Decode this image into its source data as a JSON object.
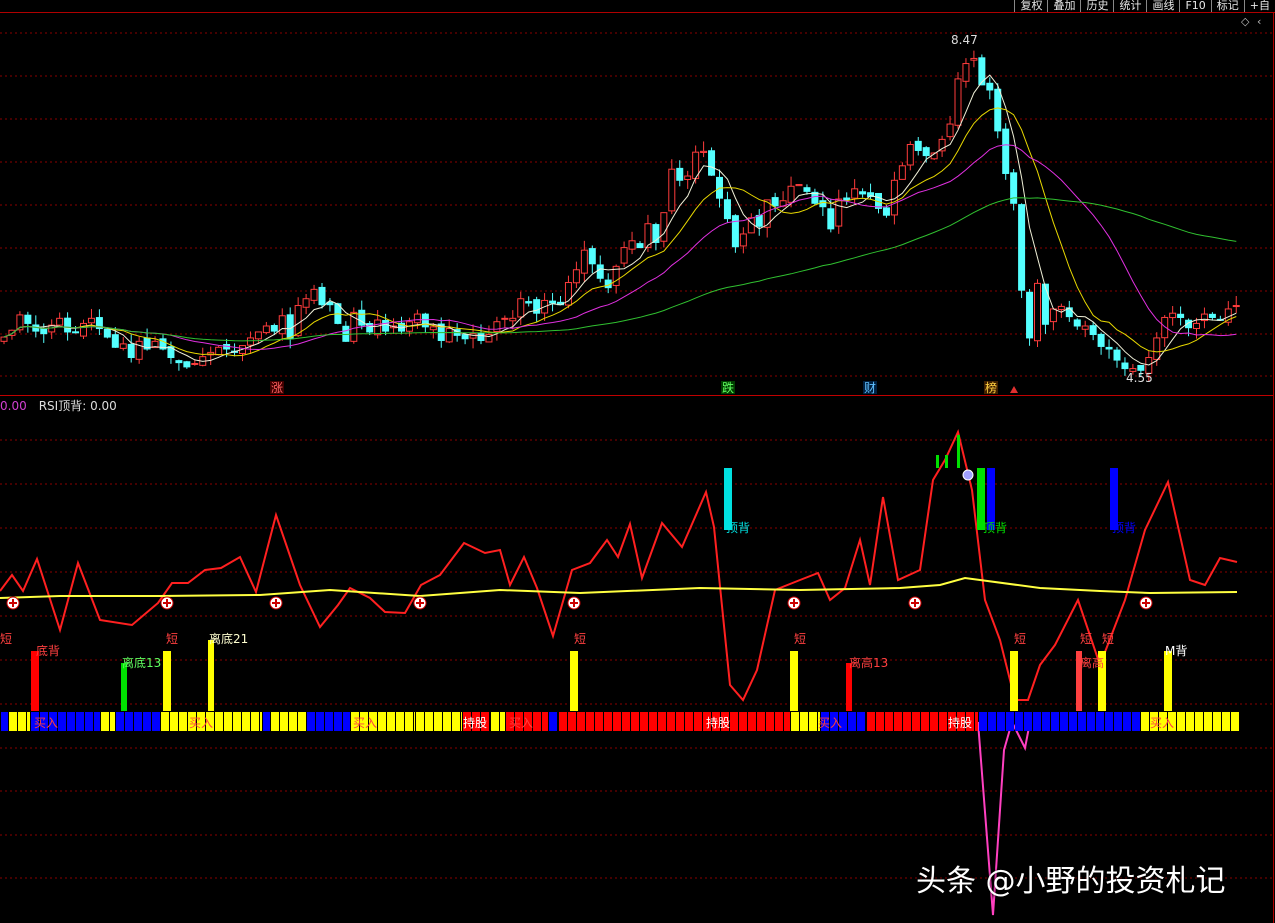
{
  "toolbar": {
    "items": [
      "复权",
      "叠加",
      "历史",
      "统计",
      "画线",
      "F10",
      "标记",
      "+自"
    ]
  },
  "indicator_header": {
    "value_a": "0.00",
    "label": "RSI顶背: 0.00"
  },
  "watermark": "头条 @小野的投资札记",
  "colors": {
    "background": "#000000",
    "grid": "#8a0000",
    "up_candle": "#ff3c3c",
    "down_candle": "#54ffff",
    "ma_white": "#f0f0d8",
    "ma_yellow": "#e8d800",
    "ma_magenta": "#e030e0",
    "ma_green": "#30c030",
    "rsi_line": "#ff2020",
    "rsi_avg": "#ffff40",
    "state_red": "#ff0000",
    "state_blue": "#0000ff",
    "state_yellow": "#ffff00"
  },
  "chart_data": [
    {
      "type": "candlestick",
      "price_annotations": {
        "high": "8.47",
        "low": "4.55"
      },
      "event_markers": [
        "涨",
        "跌",
        "财",
        "榜"
      ],
      "closes": [
        4.96,
        5.04,
        5.22,
        5.12,
        5.03,
        5.0,
        5.1,
        5.18,
        5.02,
        5.01,
        5.12,
        5.18,
        5.06,
        4.96,
        4.84,
        4.88,
        4.72,
        4.91,
        4.82,
        4.91,
        4.82,
        4.72,
        4.66,
        4.61,
        4.65,
        4.73,
        4.78,
        4.84,
        4.82,
        4.78,
        4.86,
        4.95,
        5.02,
        5.09,
        5.03,
        5.21,
        4.94,
        5.33,
        5.41,
        5.52,
        5.34,
        5.34,
        5.12,
        4.91,
        5.25,
        5.1,
        5.02,
        5.16,
        5.03,
        5.09,
        5.03,
        5.14,
        5.23,
        5.08,
        5.08,
        4.92,
        5.06,
        4.98,
        4.94,
        5.0,
        4.92,
        4.99,
        5.14,
        5.18,
        5.18,
        5.41,
        5.36,
        5.24,
        5.39,
        5.36,
        5.34,
        5.6,
        5.75,
        5.98,
        5.82,
        5.65,
        5.54,
        5.79,
        6.01,
        6.09,
        6.01,
        6.29,
        6.07,
        6.42,
        6.93,
        6.8,
        6.85,
        7.13,
        7.14,
        6.86,
        6.59,
        6.35,
        6.02,
        6.17,
        6.36,
        6.26,
        6.57,
        6.5,
        6.56,
        6.73,
        6.75,
        6.67,
        6.53,
        6.49,
        6.23,
        6.58,
        6.57,
        6.7,
        6.64,
        6.61,
        6.47,
        6.39,
        6.8,
        6.97,
        7.22,
        7.15,
        7.09,
        7.12,
        7.28,
        7.46,
        7.99,
        8.17,
        8.23,
        7.92,
        7.86,
        7.38,
        6.88,
        6.53,
        5.51,
        4.95,
        5.59,
        5.11,
        5.29,
        5.32,
        5.2,
        5.09,
        5.09,
        4.99,
        4.85,
        4.82,
        4.69,
        4.59,
        4.59,
        4.57,
        4.72,
        4.95,
        5.19,
        5.24,
        5.19,
        5.07,
        5.12,
        5.23,
        5.19,
        5.16,
        5.29,
        5.33
      ],
      "indicator_panel": {
        "series": [
          {
            "name": "RSI顶背",
            "color": "#ff2020"
          }
        ],
        "signal_labels": [
          "顶背",
          "底背",
          "短",
          "离底13",
          "离底21",
          "离高13",
          "离高",
          "M背",
          "持股",
          "买入"
        ]
      }
    }
  ]
}
